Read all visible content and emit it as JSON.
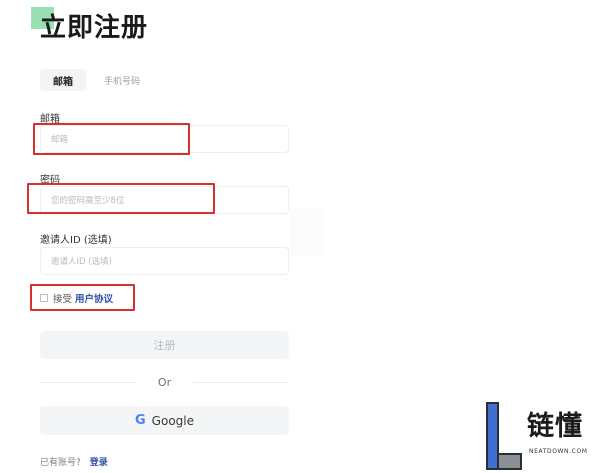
{
  "header": {
    "title": "立即注册"
  },
  "tabs": [
    {
      "label": "邮箱",
      "active": true
    },
    {
      "label": "手机号码",
      "active": false
    }
  ],
  "form": {
    "email": {
      "label": "邮箱",
      "placeholder": "邮箱"
    },
    "password": {
      "label": "密码",
      "placeholder": "您的密码需至少8位"
    },
    "invite": {
      "label": "邀请人ID (选填)",
      "placeholder": "邀请人ID (选填)"
    }
  },
  "agreement": {
    "prefix": "接受",
    "link": "用户协议",
    "checked": false
  },
  "register_button": "注册",
  "divider": "Or",
  "google": {
    "icon": "G",
    "label": "Google"
  },
  "footer": {
    "prompt": "已有账号?",
    "link": "登录"
  },
  "watermark": {
    "text": "链懂",
    "subtext": "NEATDOWN.COM"
  },
  "colors": {
    "highlight": "#d6312f",
    "link": "#2f4fa8",
    "accent_green": "#9be0b4",
    "button_bg": "#f4f5f7"
  }
}
